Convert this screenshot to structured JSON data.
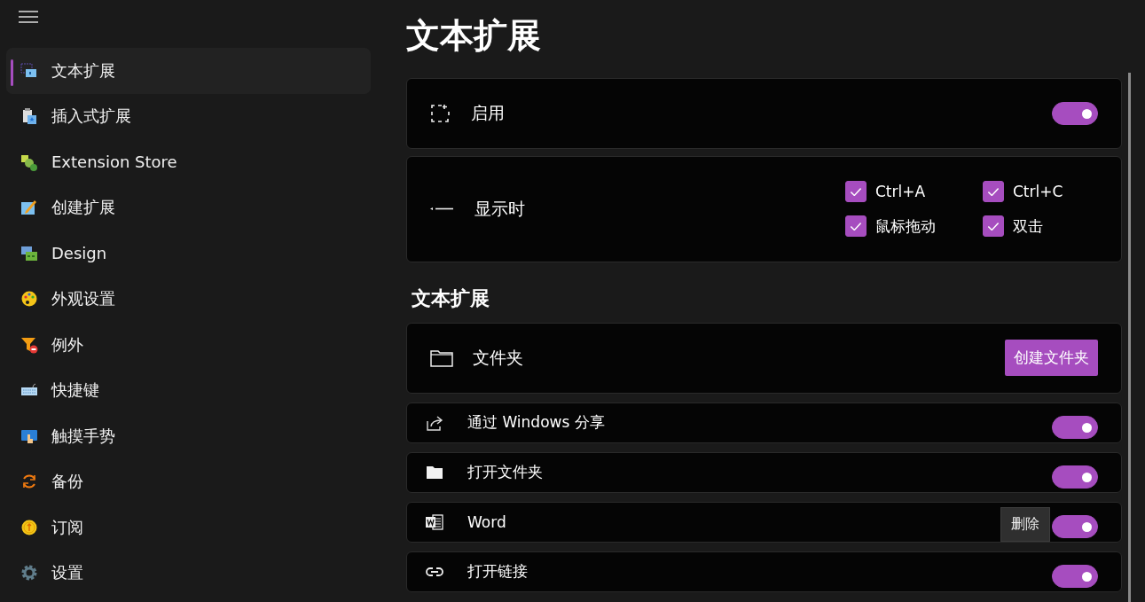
{
  "sidebar": {
    "items": [
      {
        "label": "文本扩展",
        "selected": true
      },
      {
        "label": "插入式扩展",
        "selected": false
      },
      {
        "label": "Extension Store",
        "selected": false
      },
      {
        "label": "创建扩展",
        "selected": false
      },
      {
        "label": "Design",
        "selected": false
      },
      {
        "label": "外观设置",
        "selected": false
      },
      {
        "label": "例外",
        "selected": false
      },
      {
        "label": "快捷键",
        "selected": false
      },
      {
        "label": "触摸手势",
        "selected": false
      },
      {
        "label": "备份",
        "selected": false
      },
      {
        "label": "订阅",
        "selected": false
      },
      {
        "label": "设置",
        "selected": false
      }
    ]
  },
  "page": {
    "title": "文本扩展"
  },
  "enable_card": {
    "label": "启用",
    "on": true
  },
  "show_card": {
    "label": "显示时",
    "options": [
      {
        "label": "Ctrl+A",
        "checked": true
      },
      {
        "label": "Ctrl+C",
        "checked": true
      },
      {
        "label": "鼠标拖动",
        "checked": true
      },
      {
        "label": "双击",
        "checked": true
      }
    ]
  },
  "section_title": "文本扩展",
  "folder_card": {
    "label": "文件夹",
    "button": "创建文件夹"
  },
  "extensions": [
    {
      "label": "通过 Windows 分享",
      "on": true
    },
    {
      "label": "打开文件夹",
      "on": true
    },
    {
      "label": "Word",
      "on": true,
      "tooltip": "删除"
    },
    {
      "label": "打开链接",
      "on": true
    }
  ]
}
